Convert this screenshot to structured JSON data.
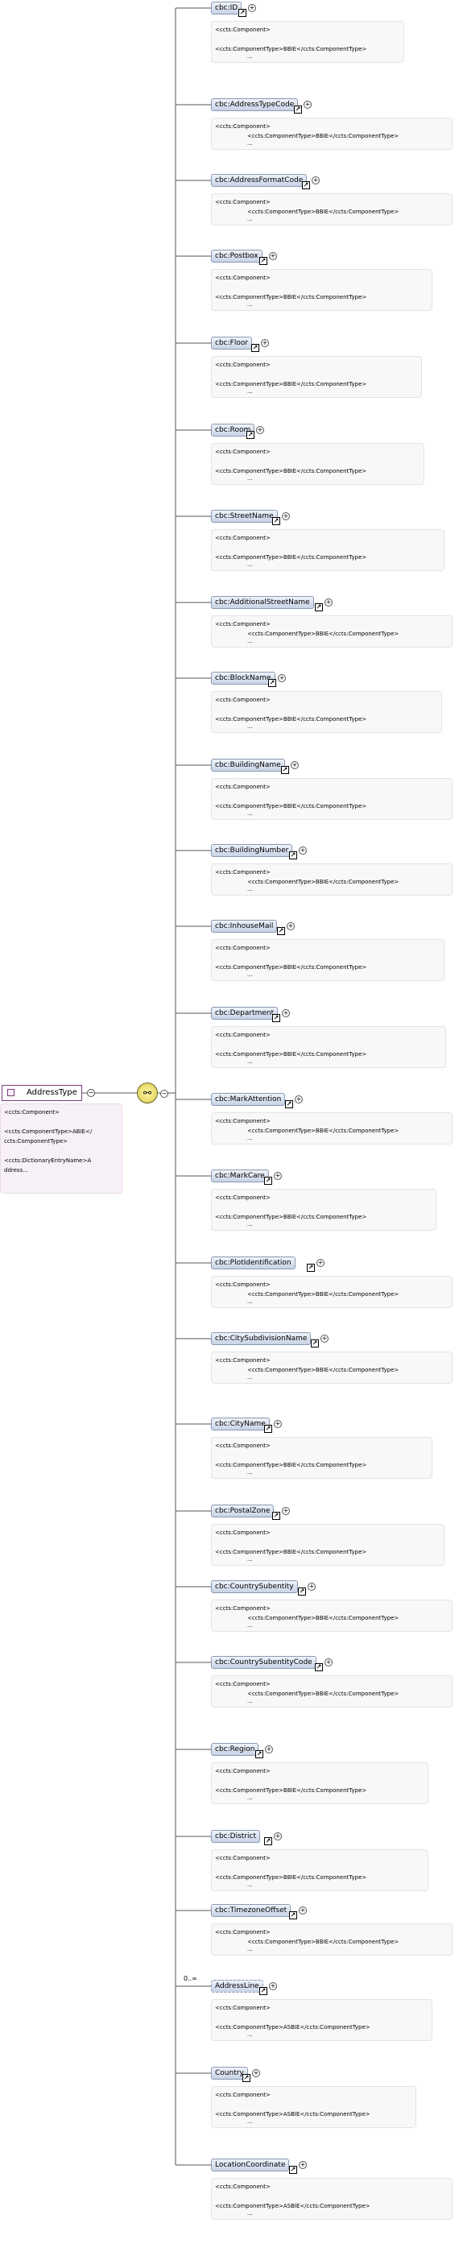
{
  "root": {
    "name": "AddressType",
    "doc": [
      "<ccts:Component>",
      "",
      "<ccts:ComponentType>ABIE</",
      "ccts:ComponentType>",
      "",
      "<ccts:DictionaryEntryName>A",
      "ddress..."
    ]
  },
  "sequence_icon": "sequence-connector-icon",
  "elements": [
    {
      "name": "cbc:ID",
      "type": "BBIE",
      "indent": false,
      "wrap": true,
      "occurs": ""
    },
    {
      "name": "cbc:AddressTypeCode",
      "type": "BBIE",
      "indent": true,
      "wrap": false,
      "occurs": ""
    },
    {
      "name": "cbc:AddressFormatCode",
      "type": "BBIE",
      "indent": true,
      "wrap": false,
      "occurs": ""
    },
    {
      "name": "cbc:Postbox",
      "type": "BBIE",
      "indent": false,
      "wrap": false,
      "occurs": ""
    },
    {
      "name": "cbc:Floor",
      "type": "BBIE",
      "indent": false,
      "wrap": false,
      "occurs": ""
    },
    {
      "name": "cbc:Room",
      "type": "BBIE",
      "indent": false,
      "wrap": false,
      "occurs": ""
    },
    {
      "name": "cbc:StreetName",
      "type": "BBIE",
      "indent": false,
      "wrap": false,
      "occurs": ""
    },
    {
      "name": "cbc:AdditionalStreetName",
      "type": "BBIE",
      "indent": true,
      "wrap": false,
      "occurs": ""
    },
    {
      "name": "cbc:BlockName",
      "type": "BBIE",
      "indent": false,
      "wrap": false,
      "occurs": ""
    },
    {
      "name": "cbc:BuildingName",
      "type": "BBIE",
      "indent": false,
      "wrap": false,
      "occurs": ""
    },
    {
      "name": "cbc:BuildingNumber",
      "type": "BBIE",
      "indent": true,
      "wrap": false,
      "occurs": ""
    },
    {
      "name": "cbc:InhouseMail",
      "type": "BBIE",
      "indent": false,
      "wrap": false,
      "occurs": ""
    },
    {
      "name": "cbc:Department",
      "type": "BBIE",
      "indent": false,
      "wrap": false,
      "occurs": ""
    },
    {
      "name": "cbc:MarkAttention",
      "type": "BBIE",
      "indent": true,
      "wrap": false,
      "occurs": ""
    },
    {
      "name": "cbc:MarkCare",
      "type": "BBIE",
      "indent": false,
      "wrap": false,
      "occurs": ""
    },
    {
      "name": "cbc:PlotIdentification",
      "type": "BBIE",
      "indent": true,
      "wrap": false,
      "occurs": ""
    },
    {
      "name": "cbc:CitySubdivisionName",
      "type": "BBIE",
      "indent": true,
      "wrap": false,
      "occurs": ""
    },
    {
      "name": "cbc:CityName",
      "type": "BBIE",
      "indent": false,
      "wrap": false,
      "occurs": ""
    },
    {
      "name": "cbc:PostalZone",
      "type": "BBIE",
      "indent": false,
      "wrap": false,
      "occurs": ""
    },
    {
      "name": "cbc:CountrySubentity",
      "type": "BBIE",
      "indent": true,
      "wrap": false,
      "occurs": ""
    },
    {
      "name": "cbc:CountrySubentityCode",
      "type": "BBIE",
      "indent": true,
      "wrap": false,
      "occurs": ""
    },
    {
      "name": "cbc:Region",
      "type": "BBIE",
      "indent": false,
      "wrap": false,
      "occurs": ""
    },
    {
      "name": "cbc:District",
      "type": "BBIE",
      "indent": false,
      "wrap": false,
      "occurs": ""
    },
    {
      "name": "cbc:TimezoneOffset",
      "type": "BBIE",
      "indent": true,
      "wrap": false,
      "occurs": ""
    },
    {
      "name": "AddressLine",
      "type": "ASBIE",
      "indent": false,
      "wrap": false,
      "occurs": "0..∞"
    },
    {
      "name": "Country",
      "type": "ASBIE",
      "indent": false,
      "wrap": true,
      "occurs": ""
    },
    {
      "name": "LocationCoordinate",
      "type": "ASBIE",
      "indent": false,
      "wrap": false,
      "occurs": ""
    }
  ],
  "doc_component": "<ccts:Component>",
  "doc_type_prefix": "<ccts:ComponentType>",
  "doc_type_suffix": "</ccts:ComponentType>",
  "doc_more": "...",
  "icons": {
    "link": "link-arrow-icon",
    "expand": "expand-plus-icon"
  }
}
